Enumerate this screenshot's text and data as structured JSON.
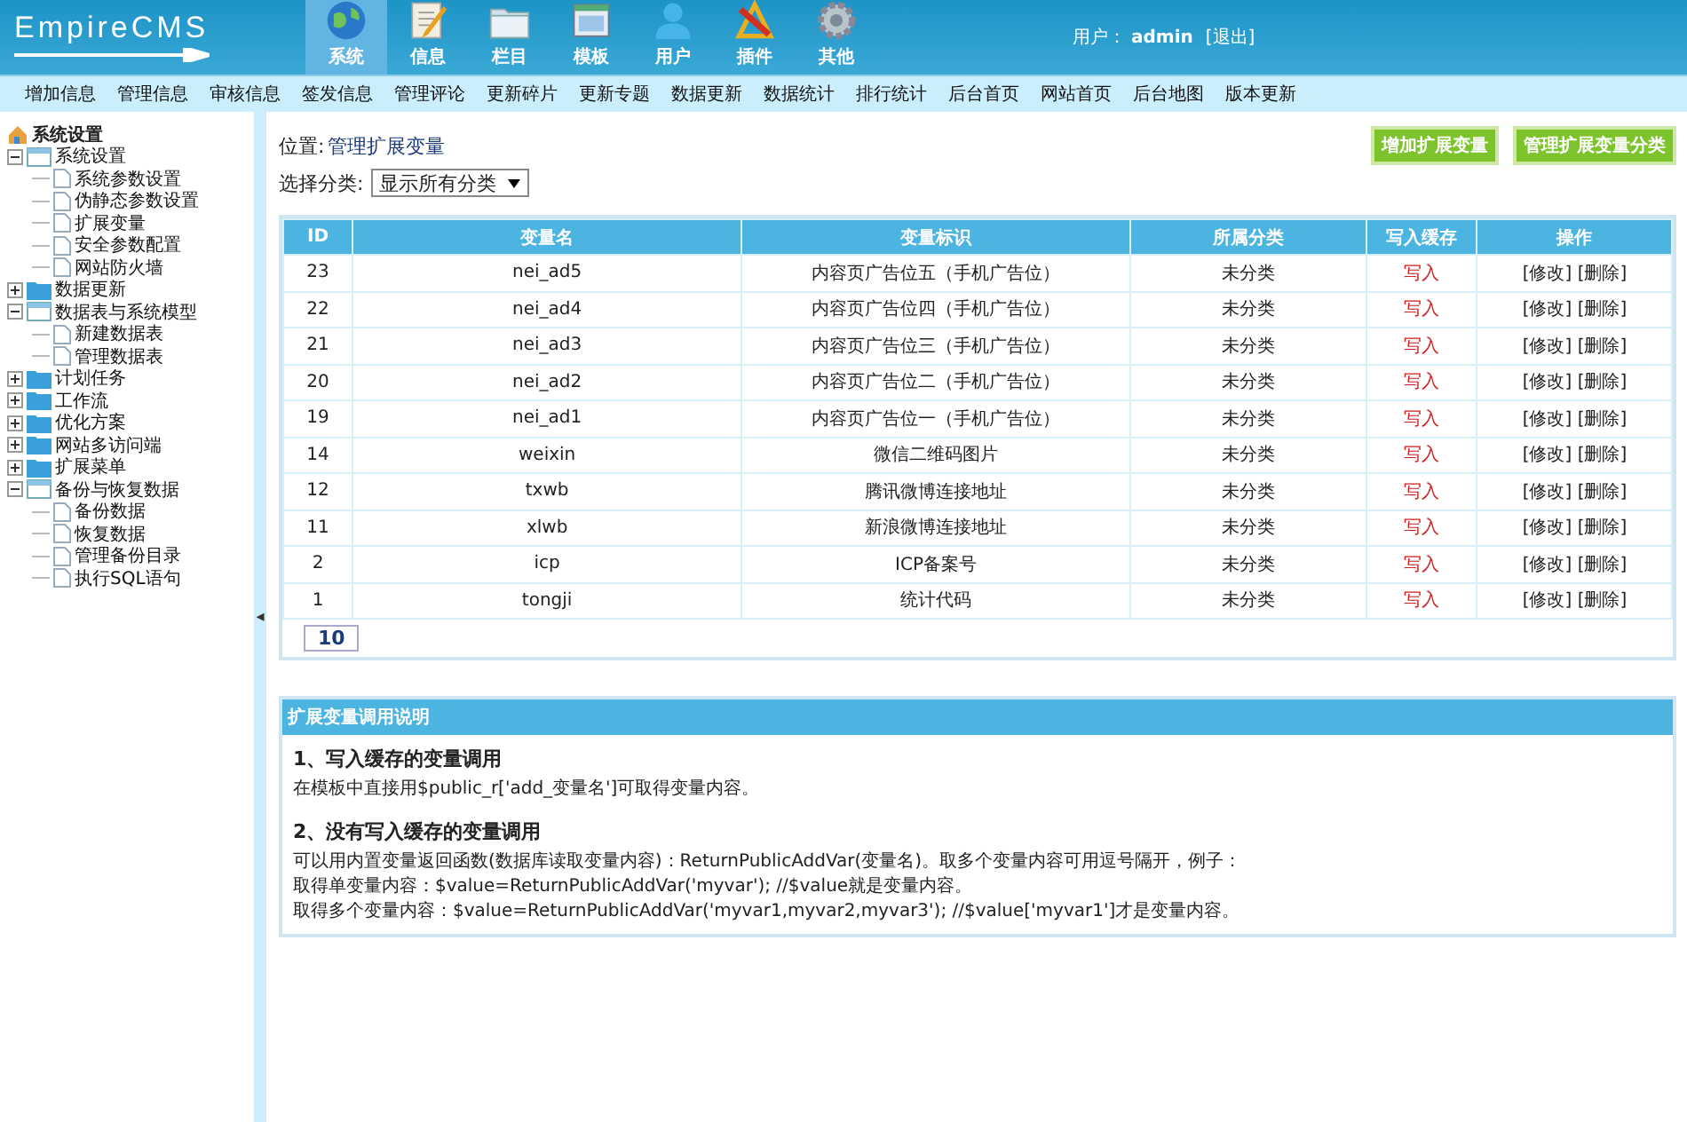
{
  "header": {
    "logo": "EmpireCMS",
    "tabs": [
      {
        "label": "系统",
        "selected": true
      },
      {
        "label": "信息",
        "selected": false
      },
      {
        "label": "栏目",
        "selected": false
      },
      {
        "label": "模板",
        "selected": false
      },
      {
        "label": "用户",
        "selected": false
      },
      {
        "label": "插件",
        "selected": false
      },
      {
        "label": "其他",
        "selected": false
      }
    ],
    "user_label": "用户：",
    "user": "admin",
    "logout": "[退出]"
  },
  "menu": [
    "增加信息",
    "管理信息",
    "审核信息",
    "签发信息",
    "管理评论",
    "更新碎片",
    "更新专题",
    "数据更新",
    "数据统计",
    "排行统计",
    "后台首页",
    "网站首页",
    "后台地图",
    "版本更新"
  ],
  "sidebar": {
    "title": "系统设置",
    "items": [
      {
        "label": "系统设置",
        "expanded": true,
        "children": [
          {
            "label": "系统参数设置"
          },
          {
            "label": "伪静态参数设置"
          },
          {
            "label": "扩展变量"
          },
          {
            "label": "安全参数配置"
          },
          {
            "label": "网站防火墙"
          }
        ]
      },
      {
        "label": "数据更新",
        "expanded": false
      },
      {
        "label": "数据表与系统模型",
        "expanded": true,
        "children": [
          {
            "label": "新建数据表"
          },
          {
            "label": "管理数据表"
          }
        ]
      },
      {
        "label": "计划任务",
        "expanded": false
      },
      {
        "label": "工作流",
        "expanded": false
      },
      {
        "label": "优化方案",
        "expanded": false
      },
      {
        "label": "网站多访问端",
        "expanded": false
      },
      {
        "label": "扩展菜单",
        "expanded": false
      },
      {
        "label": "备份与恢复数据",
        "expanded": true,
        "children": [
          {
            "label": "备份数据"
          },
          {
            "label": "恢复数据"
          },
          {
            "label": "管理备份目录"
          },
          {
            "label": "执行SQL语句"
          }
        ]
      }
    ],
    "collapse": "◂"
  },
  "breadcrumb": {
    "label": "位置:",
    "link": "管理扩展变量"
  },
  "buttons": [
    "增加扩展变量",
    "管理扩展变量分类"
  ],
  "filter": {
    "label": "选择分类:",
    "value": "显示所有分类"
  },
  "table": {
    "columns": [
      "ID",
      "变量名",
      "变量标识",
      "所属分类",
      "写入缓存",
      "操作"
    ],
    "rows": [
      {
        "id": "23",
        "name": "nei_ad5",
        "title": "内容页广告位五（手机广告位）",
        "category": "未分类",
        "cache": "写入",
        "edit": "[修改]",
        "delete": "[删除]"
      },
      {
        "id": "22",
        "name": "nei_ad4",
        "title": "内容页广告位四（手机广告位）",
        "category": "未分类",
        "cache": "写入",
        "edit": "[修改]",
        "delete": "[删除]"
      },
      {
        "id": "21",
        "name": "nei_ad3",
        "title": "内容页广告位三（手机广告位）",
        "category": "未分类",
        "cache": "写入",
        "edit": "[修改]",
        "delete": "[删除]"
      },
      {
        "id": "20",
        "name": "nei_ad2",
        "title": "内容页广告位二（手机广告位）",
        "category": "未分类",
        "cache": "写入",
        "edit": "[修改]",
        "delete": "[删除]"
      },
      {
        "id": "19",
        "name": "nei_ad1",
        "title": "内容页广告位一（手机广告位）",
        "category": "未分类",
        "cache": "写入",
        "edit": "[修改]",
        "delete": "[删除]"
      },
      {
        "id": "14",
        "name": "weixin",
        "title": "微信二维码图片",
        "category": "未分类",
        "cache": "写入",
        "edit": "[修改]",
        "delete": "[删除]"
      },
      {
        "id": "12",
        "name": "txwb",
        "title": "腾讯微博连接地址",
        "category": "未分类",
        "cache": "写入",
        "edit": "[修改]",
        "delete": "[删除]"
      },
      {
        "id": "11",
        "name": "xlwb",
        "title": "新浪微博连接地址",
        "category": "未分类",
        "cache": "写入",
        "edit": "[修改]",
        "delete": "[删除]"
      },
      {
        "id": "2",
        "name": "icp",
        "title": "ICP备案号",
        "category": "未分类",
        "cache": "写入",
        "edit": "[修改]",
        "delete": "[删除]"
      },
      {
        "id": "1",
        "name": "tongji",
        "title": "统计代码",
        "category": "未分类",
        "cache": "写入",
        "edit": "[修改]",
        "delete": "[删除]"
      }
    ],
    "total": "10"
  },
  "help": {
    "title": "扩展变量调用说明",
    "sections": [
      {
        "heading": "1、写入缓存的变量调用",
        "lines": [
          "在模板中直接用$public_r['add_变量名']可取得变量内容。"
        ]
      },
      {
        "heading": "2、没有写入缓存的变量调用",
        "lines": [
          "可以用内置变量返回函数(数据库读取变量内容)：ReturnPublicAddVar(变量名)。取多个变量内容可用逗号隔开，例子：",
          "取得单变量内容：$value=ReturnPublicAddVar('myvar'); //$value就是变量内容。",
          "取得多个变量内容：$value=ReturnPublicAddVar('myvar1,myvar2,myvar3'); //$value['myvar1']才是变量内容。"
        ]
      }
    ]
  }
}
